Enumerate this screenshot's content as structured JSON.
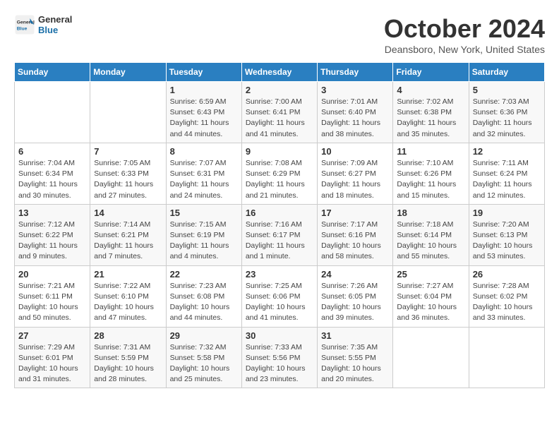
{
  "header": {
    "logo_line1": "General",
    "logo_line2": "Blue",
    "month": "October 2024",
    "location": "Deansboro, New York, United States"
  },
  "days_of_week": [
    "Sunday",
    "Monday",
    "Tuesday",
    "Wednesday",
    "Thursday",
    "Friday",
    "Saturday"
  ],
  "weeks": [
    [
      {
        "day": "",
        "sunrise": "",
        "sunset": "",
        "daylight": ""
      },
      {
        "day": "",
        "sunrise": "",
        "sunset": "",
        "daylight": ""
      },
      {
        "day": "1",
        "sunrise": "Sunrise: 6:59 AM",
        "sunset": "Sunset: 6:43 PM",
        "daylight": "Daylight: 11 hours and 44 minutes."
      },
      {
        "day": "2",
        "sunrise": "Sunrise: 7:00 AM",
        "sunset": "Sunset: 6:41 PM",
        "daylight": "Daylight: 11 hours and 41 minutes."
      },
      {
        "day": "3",
        "sunrise": "Sunrise: 7:01 AM",
        "sunset": "Sunset: 6:40 PM",
        "daylight": "Daylight: 11 hours and 38 minutes."
      },
      {
        "day": "4",
        "sunrise": "Sunrise: 7:02 AM",
        "sunset": "Sunset: 6:38 PM",
        "daylight": "Daylight: 11 hours and 35 minutes."
      },
      {
        "day": "5",
        "sunrise": "Sunrise: 7:03 AM",
        "sunset": "Sunset: 6:36 PM",
        "daylight": "Daylight: 11 hours and 32 minutes."
      }
    ],
    [
      {
        "day": "6",
        "sunrise": "Sunrise: 7:04 AM",
        "sunset": "Sunset: 6:34 PM",
        "daylight": "Daylight: 11 hours and 30 minutes."
      },
      {
        "day": "7",
        "sunrise": "Sunrise: 7:05 AM",
        "sunset": "Sunset: 6:33 PM",
        "daylight": "Daylight: 11 hours and 27 minutes."
      },
      {
        "day": "8",
        "sunrise": "Sunrise: 7:07 AM",
        "sunset": "Sunset: 6:31 PM",
        "daylight": "Daylight: 11 hours and 24 minutes."
      },
      {
        "day": "9",
        "sunrise": "Sunrise: 7:08 AM",
        "sunset": "Sunset: 6:29 PM",
        "daylight": "Daylight: 11 hours and 21 minutes."
      },
      {
        "day": "10",
        "sunrise": "Sunrise: 7:09 AM",
        "sunset": "Sunset: 6:27 PM",
        "daylight": "Daylight: 11 hours and 18 minutes."
      },
      {
        "day": "11",
        "sunrise": "Sunrise: 7:10 AM",
        "sunset": "Sunset: 6:26 PM",
        "daylight": "Daylight: 11 hours and 15 minutes."
      },
      {
        "day": "12",
        "sunrise": "Sunrise: 7:11 AM",
        "sunset": "Sunset: 6:24 PM",
        "daylight": "Daylight: 11 hours and 12 minutes."
      }
    ],
    [
      {
        "day": "13",
        "sunrise": "Sunrise: 7:12 AM",
        "sunset": "Sunset: 6:22 PM",
        "daylight": "Daylight: 11 hours and 9 minutes."
      },
      {
        "day": "14",
        "sunrise": "Sunrise: 7:14 AM",
        "sunset": "Sunset: 6:21 PM",
        "daylight": "Daylight: 11 hours and 7 minutes."
      },
      {
        "day": "15",
        "sunrise": "Sunrise: 7:15 AM",
        "sunset": "Sunset: 6:19 PM",
        "daylight": "Daylight: 11 hours and 4 minutes."
      },
      {
        "day": "16",
        "sunrise": "Sunrise: 7:16 AM",
        "sunset": "Sunset: 6:17 PM",
        "daylight": "Daylight: 11 hours and 1 minute."
      },
      {
        "day": "17",
        "sunrise": "Sunrise: 7:17 AM",
        "sunset": "Sunset: 6:16 PM",
        "daylight": "Daylight: 10 hours and 58 minutes."
      },
      {
        "day": "18",
        "sunrise": "Sunrise: 7:18 AM",
        "sunset": "Sunset: 6:14 PM",
        "daylight": "Daylight: 10 hours and 55 minutes."
      },
      {
        "day": "19",
        "sunrise": "Sunrise: 7:20 AM",
        "sunset": "Sunset: 6:13 PM",
        "daylight": "Daylight: 10 hours and 53 minutes."
      }
    ],
    [
      {
        "day": "20",
        "sunrise": "Sunrise: 7:21 AM",
        "sunset": "Sunset: 6:11 PM",
        "daylight": "Daylight: 10 hours and 50 minutes."
      },
      {
        "day": "21",
        "sunrise": "Sunrise: 7:22 AM",
        "sunset": "Sunset: 6:10 PM",
        "daylight": "Daylight: 10 hours and 47 minutes."
      },
      {
        "day": "22",
        "sunrise": "Sunrise: 7:23 AM",
        "sunset": "Sunset: 6:08 PM",
        "daylight": "Daylight: 10 hours and 44 minutes."
      },
      {
        "day": "23",
        "sunrise": "Sunrise: 7:25 AM",
        "sunset": "Sunset: 6:06 PM",
        "daylight": "Daylight: 10 hours and 41 minutes."
      },
      {
        "day": "24",
        "sunrise": "Sunrise: 7:26 AM",
        "sunset": "Sunset: 6:05 PM",
        "daylight": "Daylight: 10 hours and 39 minutes."
      },
      {
        "day": "25",
        "sunrise": "Sunrise: 7:27 AM",
        "sunset": "Sunset: 6:04 PM",
        "daylight": "Daylight: 10 hours and 36 minutes."
      },
      {
        "day": "26",
        "sunrise": "Sunrise: 7:28 AM",
        "sunset": "Sunset: 6:02 PM",
        "daylight": "Daylight: 10 hours and 33 minutes."
      }
    ],
    [
      {
        "day": "27",
        "sunrise": "Sunrise: 7:29 AM",
        "sunset": "Sunset: 6:01 PM",
        "daylight": "Daylight: 10 hours and 31 minutes."
      },
      {
        "day": "28",
        "sunrise": "Sunrise: 7:31 AM",
        "sunset": "Sunset: 5:59 PM",
        "daylight": "Daylight: 10 hours and 28 minutes."
      },
      {
        "day": "29",
        "sunrise": "Sunrise: 7:32 AM",
        "sunset": "Sunset: 5:58 PM",
        "daylight": "Daylight: 10 hours and 25 minutes."
      },
      {
        "day": "30",
        "sunrise": "Sunrise: 7:33 AM",
        "sunset": "Sunset: 5:56 PM",
        "daylight": "Daylight: 10 hours and 23 minutes."
      },
      {
        "day": "31",
        "sunrise": "Sunrise: 7:35 AM",
        "sunset": "Sunset: 5:55 PM",
        "daylight": "Daylight: 10 hours and 20 minutes."
      },
      {
        "day": "",
        "sunrise": "",
        "sunset": "",
        "daylight": ""
      },
      {
        "day": "",
        "sunrise": "",
        "sunset": "",
        "daylight": ""
      }
    ]
  ]
}
